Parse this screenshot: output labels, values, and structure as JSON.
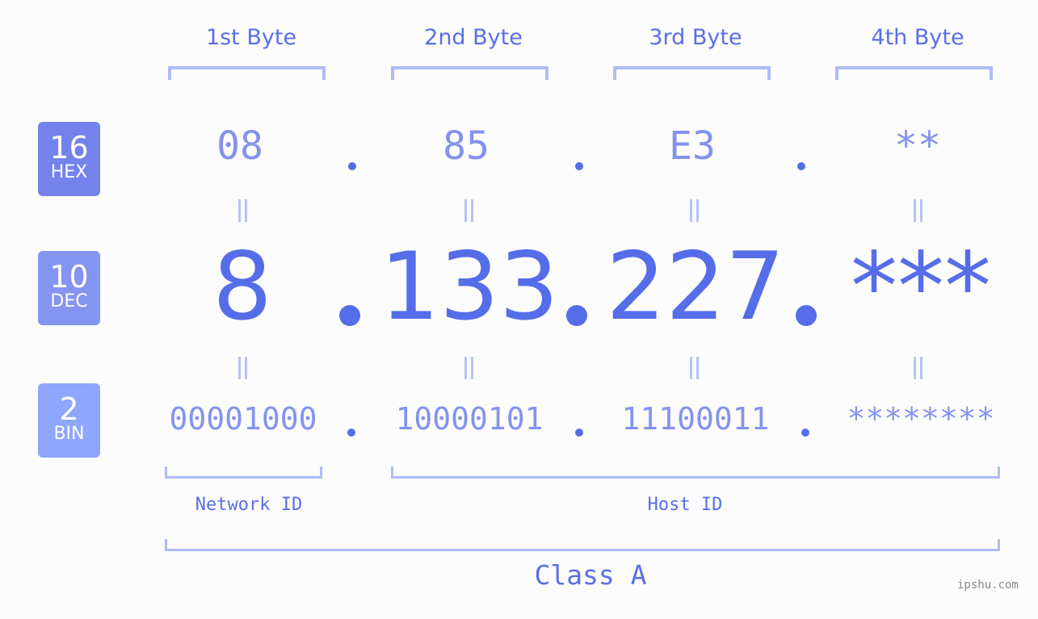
{
  "headers": [
    "1st Byte",
    "2nd Byte",
    "3rd Byte",
    "4th Byte"
  ],
  "badges": {
    "hex": {
      "num": "16",
      "label": "HEX"
    },
    "dec": {
      "num": "10",
      "label": "DEC"
    },
    "bin": {
      "num": "2",
      "label": "BIN"
    }
  },
  "hex_values": [
    "08",
    "85",
    "E3",
    "**"
  ],
  "dec_values": [
    "8",
    "133",
    "227",
    "***"
  ],
  "bin_values": [
    "00001000",
    "10000101",
    "11100011",
    "********"
  ],
  "network_id_label": "Network ID",
  "host_id_label": "Host ID",
  "class_label": "Class A",
  "watermark": "ipshu.com",
  "colors": {
    "accent": "#566de9",
    "hex_badge": "#7483ec",
    "dec_badge": "#8494f1",
    "bin_badge": "#8ea6fb",
    "bracket": "#b0bbf6"
  }
}
